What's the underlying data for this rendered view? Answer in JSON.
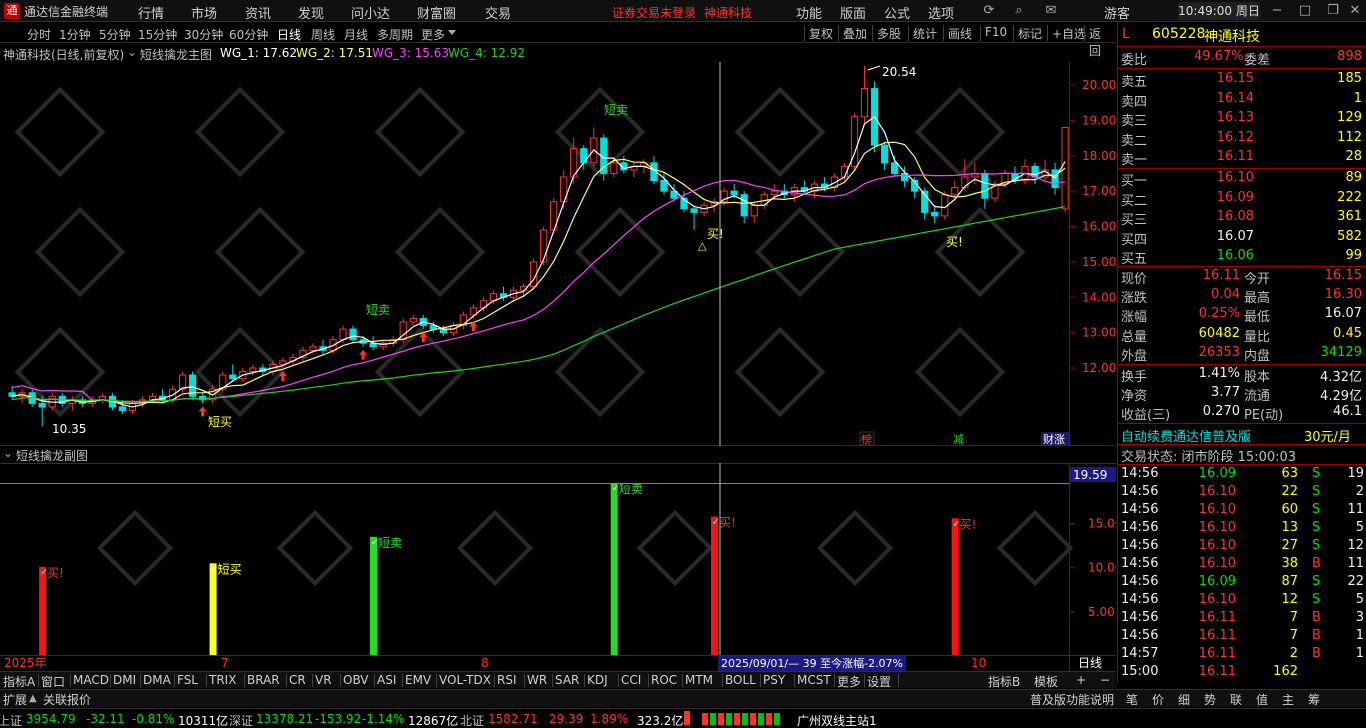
{
  "titlebar": {
    "app_title": "通达信金融终端",
    "menus": [
      "行情",
      "市场",
      "资讯",
      "发现",
      "问小达",
      "财富圈",
      "交易"
    ],
    "warning": "证券交易未登录",
    "stock_name": "神通科技",
    "right_menus": [
      "功能",
      "版面",
      "公式",
      "选项"
    ],
    "user": "游客",
    "clock": "10:49:00 周日"
  },
  "periods": [
    "分时",
    "1分钟",
    "5分钟",
    "15分钟",
    "30分钟",
    "60分钟",
    "日线",
    "周线",
    "月线",
    "多周期",
    "更多"
  ],
  "active_period": "日线",
  "toolbar_buttons": [
    "复权",
    "叠加",
    "多股",
    "统计",
    "画线",
    "F10",
    "标记",
    "+自选",
    "返回"
  ],
  "chart_header": {
    "name": "神通科技(日线,前复权)",
    "formula": "短线擒龙主图",
    "wg1": "WG_1: 17.62",
    "wg2": "WG_2: 17.51",
    "wg3": "WG_3: 15.63",
    "wg4": "WG_4: 12.92"
  },
  "main_axis_ticks": [
    "20.00",
    "19.00",
    "18.00",
    "17.00",
    "16.00",
    "15.00",
    "14.00",
    "13.00",
    "12.00"
  ],
  "annotations": {
    "high_label": "20.54",
    "low_label": "10.35",
    "short_sell": "短卖",
    "short_buy": "短买",
    "buy": "买!",
    "marks": [
      "榜",
      "减",
      "财",
      "涨"
    ]
  },
  "sub_header": "短线擒龙副图",
  "sub_axis_ticks": [
    "19.59",
    "15.00",
    "10.00",
    "5.00"
  ],
  "sub_labels": [
    "买!",
    "短买",
    "短卖",
    "短卖",
    "买!",
    "买!"
  ],
  "date_axis": {
    "labels": [
      "2025年",
      "7",
      "8",
      "10"
    ],
    "range_info": "2025/09/01/— 39 至今涨幅-2.07%",
    "mode": "日线"
  },
  "quote": {
    "flag": "L",
    "code": "605228",
    "name": "神通科技",
    "weibi_label": "委比",
    "weibi": "49.67%",
    "weicha_label": "委差",
    "weicha": "898",
    "sells": [
      {
        "label": "卖五",
        "price": "16.15",
        "vol": "185"
      },
      {
        "label": "卖四",
        "price": "16.14",
        "vol": "1"
      },
      {
        "label": "卖三",
        "price": "16.13",
        "vol": "129"
      },
      {
        "label": "卖二",
        "price": "16.12",
        "vol": "112"
      },
      {
        "label": "卖一",
        "price": "16.11",
        "vol": "28"
      }
    ],
    "buys": [
      {
        "label": "买一",
        "price": "16.10",
        "vol": "89"
      },
      {
        "label": "买二",
        "price": "16.09",
        "vol": "222"
      },
      {
        "label": "买三",
        "price": "16.08",
        "vol": "361"
      },
      {
        "label": "买四",
        "price": "16.07",
        "vol": "582"
      },
      {
        "label": "买五",
        "price": "16.06",
        "vol": "99"
      }
    ],
    "stats": [
      {
        "l1": "现价",
        "v1": "16.11",
        "c1": "red",
        "l2": "今开",
        "v2": "16.15",
        "c2": "red"
      },
      {
        "l1": "涨跌",
        "v1": "0.04",
        "c1": "red",
        "l2": "最高",
        "v2": "16.30",
        "c2": "red"
      },
      {
        "l1": "涨幅",
        "v1": "0.25%",
        "c1": "red",
        "l2": "最低",
        "v2": "16.07",
        "c2": "white"
      },
      {
        "l1": "总量",
        "v1": "60482",
        "c1": "yellow",
        "l2": "量比",
        "v2": "0.45",
        "c2": "yellow"
      },
      {
        "l1": "外盘",
        "v1": "26353",
        "c1": "red",
        "l2": "内盘",
        "v2": "34129",
        "c2": "green"
      }
    ],
    "stats2": [
      {
        "l1": "换手",
        "v1": "1.41%",
        "l2": "股本",
        "v2": "4.32亿"
      },
      {
        "l1": "净资",
        "v1": "3.77",
        "l2": "流通",
        "v2": "4.29亿"
      },
      {
        "l1": "收益(三)",
        "v1": "0.270",
        "l2": "PE(动)",
        "v2": "46.1"
      }
    ],
    "promo": "自动续费通达信普及版",
    "promo_price": "30元/月",
    "trade_status": "交易状态: 闭市阶段 15:00:03",
    "ticks": [
      {
        "t": "14:56",
        "p": "16.09",
        "v": "63",
        "s": "S",
        "n": "19",
        "pc": "green",
        "sc": "green"
      },
      {
        "t": "14:56",
        "p": "16.10",
        "v": "22",
        "s": "S",
        "n": "2",
        "pc": "red",
        "sc": "green"
      },
      {
        "t": "14:56",
        "p": "16.10",
        "v": "60",
        "s": "S",
        "n": "11",
        "pc": "red",
        "sc": "green"
      },
      {
        "t": "14:56",
        "p": "16.10",
        "v": "13",
        "s": "S",
        "n": "5",
        "pc": "red",
        "sc": "green"
      },
      {
        "t": "14:56",
        "p": "16.10",
        "v": "27",
        "s": "S",
        "n": "12",
        "pc": "red",
        "sc": "green"
      },
      {
        "t": "14:56",
        "p": "16.10",
        "v": "38",
        "s": "B",
        "n": "11",
        "pc": "red",
        "sc": "red"
      },
      {
        "t": "14:56",
        "p": "16.09",
        "v": "87",
        "s": "S",
        "n": "22",
        "pc": "green",
        "sc": "green"
      },
      {
        "t": "14:56",
        "p": "16.10",
        "v": "12",
        "s": "S",
        "n": "5",
        "pc": "red",
        "sc": "green"
      },
      {
        "t": "14:56",
        "p": "16.11",
        "v": "7",
        "s": "B",
        "n": "3",
        "pc": "red",
        "sc": "red"
      },
      {
        "t": "14:56",
        "p": "16.11",
        "v": "7",
        "s": "B",
        "n": "1",
        "pc": "red",
        "sc": "red"
      },
      {
        "t": "14:57",
        "p": "16.11",
        "v": "2",
        "s": "B",
        "n": "1",
        "pc": "red",
        "sc": "red"
      },
      {
        "t": "15:00",
        "p": "16.11",
        "v": "162",
        "s": "",
        "n": "",
        "pc": "red",
        "sc": "red"
      }
    ]
  },
  "indicator_tabs": [
    "指标A",
    "窗口",
    "MACD",
    "DMI",
    "DMA",
    "FSL",
    "TRIX",
    "BRAR",
    "CR",
    "VR",
    "OBV",
    "ASI",
    "EMV",
    "VOL-TDX",
    "RSI",
    "WR",
    "SAR",
    "KDJ",
    "CCI",
    "ROC",
    "MTM",
    "BOLL",
    "PSY",
    "MCST",
    "更多",
    "设置"
  ],
  "indicator_right": [
    "指标B",
    "模板",
    "+",
    "−"
  ],
  "ext_bar": {
    "left": [
      "扩展",
      "关联报价"
    ],
    "right": [
      "普及版功能说明",
      "笔",
      "价",
      "细",
      "势",
      "联",
      "值",
      "主",
      "筹"
    ]
  },
  "statusbar": {
    "sh_label": "上证",
    "sh_val": "3954.79",
    "sh_chg": "-32.11",
    "sh_pct": "-0.81%",
    "sh_amt": "10311亿",
    "sz_label": "深证",
    "sz_val": "13378.21",
    "sz_chg": "-153.92",
    "sz_pct": "-1.14%",
    "sz_amt": "12867亿",
    "bz_label": "北证",
    "bz_val": "1582.71",
    "bz_chg": "29.39",
    "bz_pct": "1.89%",
    "bz_amt": "323.2亿",
    "station": "广州双线主站1"
  },
  "colors": {
    "up": "#ff3030",
    "down": "#00e0e0",
    "ma1": "#ffffff",
    "ma2": "#ffff60",
    "ma3": "#ff40ff",
    "ma4": "#20d020",
    "frame": "#a00000"
  },
  "chart_data": {
    "type": "candlestick",
    "ylim": [
      10.0,
      21.0
    ],
    "candles": [
      [
        11.3,
        11.5,
        11.1,
        11.2
      ],
      [
        11.2,
        11.4,
        11.0,
        11.3
      ],
      [
        11.3,
        11.4,
        10.9,
        11.0
      ],
      [
        11.0,
        11.2,
        10.35,
        10.9
      ],
      [
        10.9,
        11.3,
        10.8,
        11.2
      ],
      [
        11.2,
        11.3,
        10.9,
        11.0
      ],
      [
        11.0,
        11.2,
        10.8,
        11.1
      ],
      [
        11.1,
        11.2,
        10.9,
        11.0
      ],
      [
        11.0,
        11.2,
        10.9,
        11.1
      ],
      [
        11.1,
        11.3,
        11.0,
        11.2
      ],
      [
        11.2,
        11.3,
        10.8,
        10.9
      ],
      [
        10.9,
        11.1,
        10.7,
        10.8
      ],
      [
        10.8,
        11.1,
        10.7,
        11.0
      ],
      [
        11.0,
        11.2,
        10.9,
        11.1
      ],
      [
        11.1,
        11.3,
        11.0,
        11.2
      ],
      [
        11.2,
        11.4,
        11.0,
        11.1
      ],
      [
        11.1,
        11.5,
        11.0,
        11.4
      ],
      [
        11.4,
        11.9,
        11.3,
        11.8
      ],
      [
        11.8,
        11.9,
        11.1,
        11.2
      ],
      [
        11.2,
        11.3,
        11.0,
        11.1
      ],
      [
        11.1,
        11.5,
        11.0,
        11.4
      ],
      [
        11.4,
        11.9,
        11.3,
        11.8
      ],
      [
        11.8,
        12.1,
        11.6,
        11.7
      ],
      [
        11.7,
        12.0,
        11.6,
        11.9
      ],
      [
        11.9,
        12.1,
        11.8,
        12.0
      ],
      [
        12.0,
        12.1,
        11.8,
        11.9
      ],
      [
        11.9,
        12.2,
        11.8,
        12.1
      ],
      [
        12.1,
        12.3,
        12.0,
        12.2
      ],
      [
        12.2,
        12.4,
        12.1,
        12.3
      ],
      [
        12.3,
        12.6,
        12.2,
        12.5
      ],
      [
        12.5,
        12.7,
        12.4,
        12.6
      ],
      [
        12.6,
        12.8,
        12.4,
        12.5
      ],
      [
        12.5,
        12.9,
        12.4,
        12.8
      ],
      [
        12.8,
        13.2,
        12.7,
        13.1
      ],
      [
        13.1,
        13.2,
        12.7,
        12.8
      ],
      [
        12.8,
        12.9,
        12.6,
        12.7
      ],
      [
        12.7,
        12.9,
        12.5,
        12.6
      ],
      [
        12.6,
        12.8,
        12.5,
        12.7
      ],
      [
        12.7,
        12.9,
        12.6,
        12.8
      ],
      [
        12.8,
        13.4,
        12.7,
        13.3
      ],
      [
        13.3,
        13.5,
        13.2,
        13.4
      ],
      [
        13.4,
        13.5,
        13.1,
        13.2
      ],
      [
        13.2,
        13.3,
        13.0,
        13.1
      ],
      [
        13.1,
        13.2,
        12.9,
        13.0
      ],
      [
        13.0,
        13.3,
        12.9,
        13.2
      ],
      [
        13.2,
        13.6,
        13.1,
        13.5
      ],
      [
        13.5,
        13.8,
        13.4,
        13.7
      ],
      [
        13.7,
        14.0,
        13.6,
        13.9
      ],
      [
        13.9,
        14.2,
        13.8,
        14.1
      ],
      [
        14.1,
        14.3,
        13.9,
        14.0
      ],
      [
        14.0,
        14.3,
        13.9,
        14.2
      ],
      [
        14.2,
        14.4,
        14.0,
        14.3
      ],
      [
        14.3,
        15.1,
        14.2,
        15.0
      ],
      [
        15.0,
        16.0,
        14.9,
        15.9
      ],
      [
        15.9,
        16.8,
        15.8,
        16.7
      ],
      [
        16.7,
        17.6,
        16.5,
        17.4
      ],
      [
        17.4,
        18.5,
        17.2,
        18.2
      ],
      [
        18.2,
        18.3,
        17.6,
        17.8
      ],
      [
        17.8,
        18.8,
        17.7,
        18.5
      ],
      [
        18.5,
        18.6,
        17.3,
        17.5
      ],
      [
        17.5,
        17.9,
        17.4,
        17.8
      ],
      [
        17.8,
        18.0,
        17.5,
        17.6
      ],
      [
        17.6,
        17.8,
        17.4,
        17.7
      ],
      [
        17.7,
        17.9,
        17.5,
        17.8
      ],
      [
        17.8,
        18.0,
        17.2,
        17.3
      ],
      [
        17.3,
        17.5,
        16.9,
        17.0
      ],
      [
        17.0,
        17.2,
        16.7,
        16.8
      ],
      [
        16.8,
        17.0,
        16.4,
        16.5
      ],
      [
        16.5,
        16.6,
        15.9,
        16.4
      ],
      [
        16.4,
        16.7,
        16.3,
        16.6
      ],
      [
        16.6,
        16.8,
        16.4,
        16.7
      ],
      [
        16.7,
        17.1,
        16.6,
        17.0
      ],
      [
        17.0,
        17.2,
        16.8,
        16.9
      ],
      [
        16.9,
        17.0,
        16.1,
        16.3
      ],
      [
        16.3,
        16.7,
        16.1,
        16.6
      ],
      [
        16.6,
        17.0,
        16.5,
        16.9
      ],
      [
        16.9,
        17.2,
        16.8,
        17.0
      ],
      [
        17.0,
        17.2,
        16.8,
        16.9
      ],
      [
        16.9,
        17.2,
        16.7,
        17.1
      ],
      [
        17.1,
        17.3,
        16.9,
        17.0
      ],
      [
        17.0,
        17.3,
        16.8,
        17.2
      ],
      [
        17.2,
        17.4,
        17.0,
        17.1
      ],
      [
        17.1,
        17.5,
        17.0,
        17.4
      ],
      [
        17.4,
        17.8,
        17.3,
        17.7
      ],
      [
        17.7,
        19.2,
        17.6,
        19.1
      ],
      [
        19.1,
        20.54,
        18.9,
        19.9
      ],
      [
        19.9,
        20.1,
        18.1,
        18.3
      ],
      [
        18.3,
        18.4,
        17.6,
        17.8
      ],
      [
        17.8,
        18.0,
        17.4,
        17.5
      ],
      [
        17.5,
        17.7,
        17.1,
        17.3
      ],
      [
        17.3,
        17.4,
        16.8,
        17.0
      ],
      [
        17.0,
        17.1,
        16.2,
        16.4
      ],
      [
        16.4,
        16.6,
        16.1,
        16.3
      ],
      [
        16.3,
        17.0,
        16.2,
        16.9
      ],
      [
        16.9,
        17.3,
        16.8,
        17.1
      ],
      [
        17.1,
        17.9,
        17.0,
        17.4
      ],
      [
        17.4,
        17.8,
        17.2,
        17.5
      ],
      [
        17.5,
        17.6,
        16.5,
        16.8
      ],
      [
        16.8,
        17.3,
        16.7,
        17.2
      ],
      [
        17.2,
        17.6,
        17.1,
        17.5
      ],
      [
        17.5,
        17.7,
        17.2,
        17.3
      ],
      [
        17.3,
        17.9,
        17.2,
        17.7
      ],
      [
        17.7,
        17.8,
        17.2,
        17.4
      ],
      [
        17.4,
        17.9,
        17.3,
        17.6
      ],
      [
        17.6,
        17.8,
        16.9,
        17.1
      ],
      [
        16.5,
        18.8,
        16.4,
        18.8
      ]
    ],
    "sub_bars": [
      {
        "i": 3,
        "v": 10.1,
        "color": "#ff1010"
      },
      {
        "i": 20,
        "v": 10.5,
        "color": "#ffff20"
      },
      {
        "i": 36,
        "v": 13.5,
        "color": "#20e020"
      },
      {
        "i": 60,
        "v": 19.6,
        "color": "#20e020"
      },
      {
        "i": 70,
        "v": 15.8,
        "color": "#ff1010"
      },
      {
        "i": 94,
        "v": 15.6,
        "color": "#ff1010"
      }
    ],
    "sub_ylim": [
      0,
      20
    ]
  }
}
